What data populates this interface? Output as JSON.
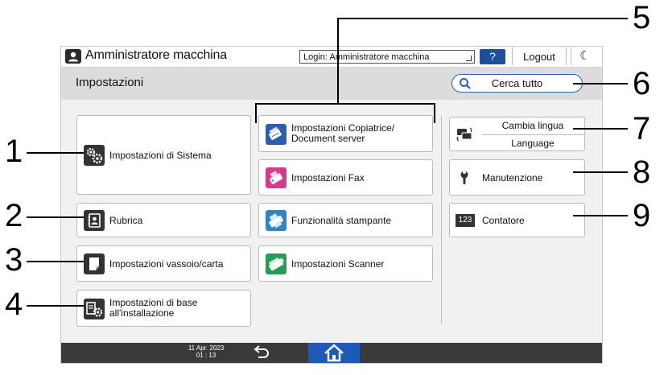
{
  "topbar": {
    "admin_label": "Amministratore macchina",
    "login_value": "Login: Amministratore macchina",
    "help_label": "?",
    "logout_label": "Logout",
    "moon_label": "☾"
  },
  "header": {
    "title": "Impostazioni",
    "search_label": "Cerca tutto"
  },
  "tiles": {
    "system": "Impostazioni di Sistema",
    "rubrica": "Rubrica",
    "tray": "Impostazioni vassoio/carta",
    "install_1": "Impostazioni di base",
    "install_2": "all'installazione",
    "copier_1": "Impostazioni Copiatrice/",
    "copier_2": "Document server",
    "fax": "Impostazioni Fax",
    "printer": "Funzionalità stampante",
    "scanner": "Impostazioni Scanner",
    "lang_1": "Cambia lingua",
    "lang_2": "Language",
    "maintenance": "Manutenzione",
    "counter_badge": "123",
    "counter": "Contatore"
  },
  "footer": {
    "date": "11 Apr. 2023",
    "time": "01 : 13"
  },
  "callouts": [
    "1",
    "2",
    "3",
    "4",
    "5",
    "6",
    "7",
    "8",
    "9"
  ],
  "colors": {
    "accent": "#2a63b8",
    "home": "#1e5bb8",
    "fax_icon": "#d23c8a",
    "copier_icon": "#2a5fb0",
    "printer_icon": "#2b86c9",
    "scanner_icon": "#2a9a5a"
  }
}
